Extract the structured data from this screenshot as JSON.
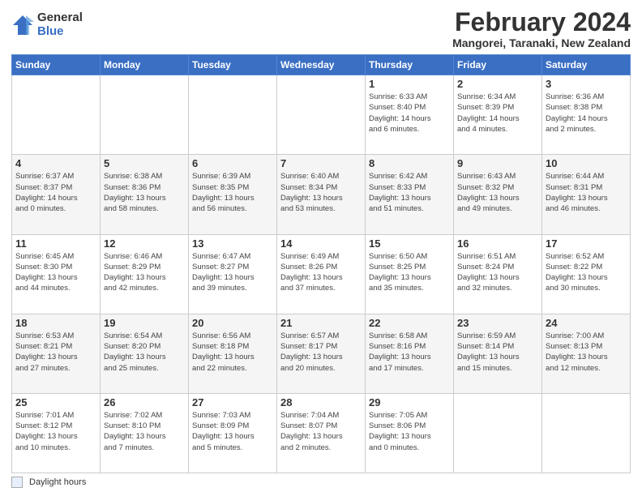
{
  "logo": {
    "general": "General",
    "blue": "Blue"
  },
  "title": "February 2024",
  "subtitle": "Mangorei, Taranaki, New Zealand",
  "weekdays": [
    "Sunday",
    "Monday",
    "Tuesday",
    "Wednesday",
    "Thursday",
    "Friday",
    "Saturday"
  ],
  "footer_label": "Daylight hours",
  "weeks": [
    [
      {
        "day": "",
        "info": ""
      },
      {
        "day": "",
        "info": ""
      },
      {
        "day": "",
        "info": ""
      },
      {
        "day": "",
        "info": ""
      },
      {
        "day": "1",
        "info": "Sunrise: 6:33 AM\nSunset: 8:40 PM\nDaylight: 14 hours\nand 6 minutes."
      },
      {
        "day": "2",
        "info": "Sunrise: 6:34 AM\nSunset: 8:39 PM\nDaylight: 14 hours\nand 4 minutes."
      },
      {
        "day": "3",
        "info": "Sunrise: 6:36 AM\nSunset: 8:38 PM\nDaylight: 14 hours\nand 2 minutes."
      }
    ],
    [
      {
        "day": "4",
        "info": "Sunrise: 6:37 AM\nSunset: 8:37 PM\nDaylight: 14 hours\nand 0 minutes."
      },
      {
        "day": "5",
        "info": "Sunrise: 6:38 AM\nSunset: 8:36 PM\nDaylight: 13 hours\nand 58 minutes."
      },
      {
        "day": "6",
        "info": "Sunrise: 6:39 AM\nSunset: 8:35 PM\nDaylight: 13 hours\nand 56 minutes."
      },
      {
        "day": "7",
        "info": "Sunrise: 6:40 AM\nSunset: 8:34 PM\nDaylight: 13 hours\nand 53 minutes."
      },
      {
        "day": "8",
        "info": "Sunrise: 6:42 AM\nSunset: 8:33 PM\nDaylight: 13 hours\nand 51 minutes."
      },
      {
        "day": "9",
        "info": "Sunrise: 6:43 AM\nSunset: 8:32 PM\nDaylight: 13 hours\nand 49 minutes."
      },
      {
        "day": "10",
        "info": "Sunrise: 6:44 AM\nSunset: 8:31 PM\nDaylight: 13 hours\nand 46 minutes."
      }
    ],
    [
      {
        "day": "11",
        "info": "Sunrise: 6:45 AM\nSunset: 8:30 PM\nDaylight: 13 hours\nand 44 minutes."
      },
      {
        "day": "12",
        "info": "Sunrise: 6:46 AM\nSunset: 8:29 PM\nDaylight: 13 hours\nand 42 minutes."
      },
      {
        "day": "13",
        "info": "Sunrise: 6:47 AM\nSunset: 8:27 PM\nDaylight: 13 hours\nand 39 minutes."
      },
      {
        "day": "14",
        "info": "Sunrise: 6:49 AM\nSunset: 8:26 PM\nDaylight: 13 hours\nand 37 minutes."
      },
      {
        "day": "15",
        "info": "Sunrise: 6:50 AM\nSunset: 8:25 PM\nDaylight: 13 hours\nand 35 minutes."
      },
      {
        "day": "16",
        "info": "Sunrise: 6:51 AM\nSunset: 8:24 PM\nDaylight: 13 hours\nand 32 minutes."
      },
      {
        "day": "17",
        "info": "Sunrise: 6:52 AM\nSunset: 8:22 PM\nDaylight: 13 hours\nand 30 minutes."
      }
    ],
    [
      {
        "day": "18",
        "info": "Sunrise: 6:53 AM\nSunset: 8:21 PM\nDaylight: 13 hours\nand 27 minutes."
      },
      {
        "day": "19",
        "info": "Sunrise: 6:54 AM\nSunset: 8:20 PM\nDaylight: 13 hours\nand 25 minutes."
      },
      {
        "day": "20",
        "info": "Sunrise: 6:56 AM\nSunset: 8:18 PM\nDaylight: 13 hours\nand 22 minutes."
      },
      {
        "day": "21",
        "info": "Sunrise: 6:57 AM\nSunset: 8:17 PM\nDaylight: 13 hours\nand 20 minutes."
      },
      {
        "day": "22",
        "info": "Sunrise: 6:58 AM\nSunset: 8:16 PM\nDaylight: 13 hours\nand 17 minutes."
      },
      {
        "day": "23",
        "info": "Sunrise: 6:59 AM\nSunset: 8:14 PM\nDaylight: 13 hours\nand 15 minutes."
      },
      {
        "day": "24",
        "info": "Sunrise: 7:00 AM\nSunset: 8:13 PM\nDaylight: 13 hours\nand 12 minutes."
      }
    ],
    [
      {
        "day": "25",
        "info": "Sunrise: 7:01 AM\nSunset: 8:12 PM\nDaylight: 13 hours\nand 10 minutes."
      },
      {
        "day": "26",
        "info": "Sunrise: 7:02 AM\nSunset: 8:10 PM\nDaylight: 13 hours\nand 7 minutes."
      },
      {
        "day": "27",
        "info": "Sunrise: 7:03 AM\nSunset: 8:09 PM\nDaylight: 13 hours\nand 5 minutes."
      },
      {
        "day": "28",
        "info": "Sunrise: 7:04 AM\nSunset: 8:07 PM\nDaylight: 13 hours\nand 2 minutes."
      },
      {
        "day": "29",
        "info": "Sunrise: 7:05 AM\nSunset: 8:06 PM\nDaylight: 13 hours\nand 0 minutes."
      },
      {
        "day": "",
        "info": ""
      },
      {
        "day": "",
        "info": ""
      }
    ]
  ]
}
